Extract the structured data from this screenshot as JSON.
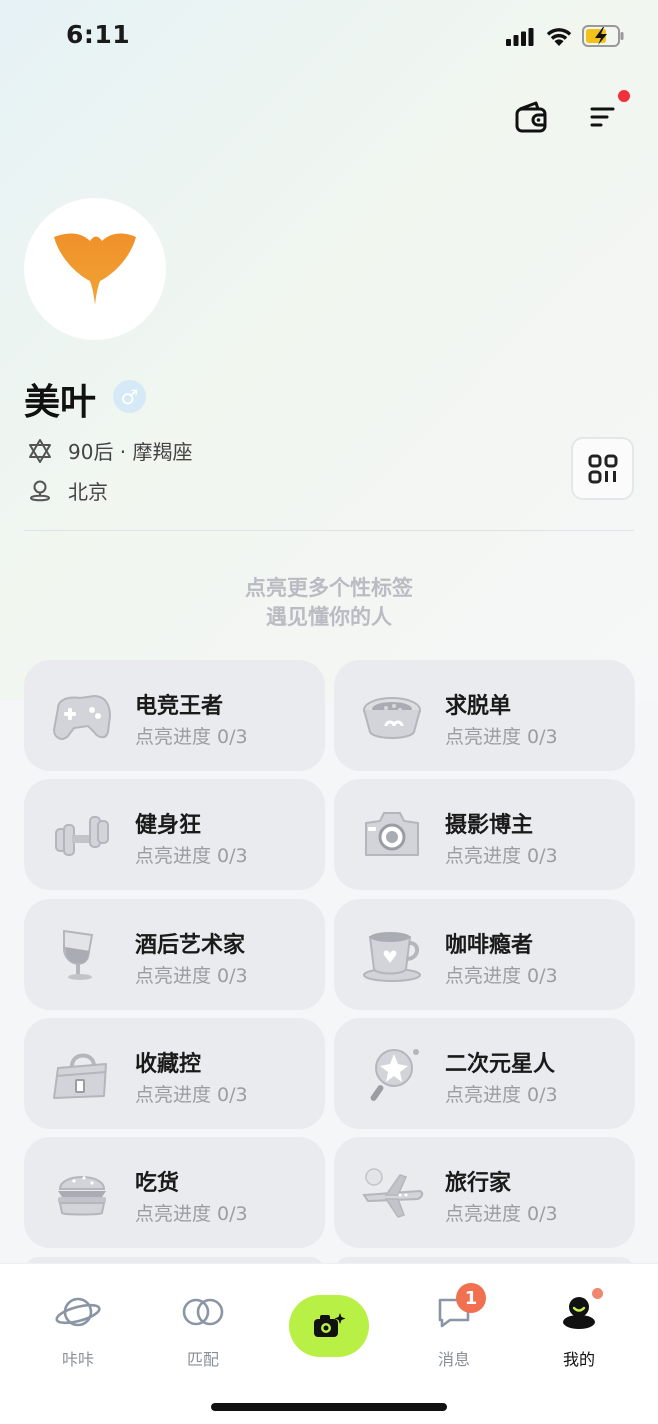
{
  "status_bar": {
    "time": "6:11"
  },
  "profile": {
    "name": "美叶",
    "gender_symbol": "♂",
    "birth_info": "90后 · 摩羯座",
    "location": "北京"
  },
  "slogan": {
    "line1": "点亮更多个性标签",
    "line2": "遇见懂你的人"
  },
  "tags": [
    {
      "title": "电竞王者",
      "progress": "点亮进度 0/3",
      "icon": "gamepad-icon"
    },
    {
      "title": "求脱单",
      "progress": "点亮进度 0/3",
      "icon": "pet-bowl-icon"
    },
    {
      "title": "健身狂",
      "progress": "点亮进度 0/3",
      "icon": "dumbbell-icon"
    },
    {
      "title": "摄影博主",
      "progress": "点亮进度 0/3",
      "icon": "camera-icon"
    },
    {
      "title": "酒后艺术家",
      "progress": "点亮进度 0/3",
      "icon": "wine-glass-icon"
    },
    {
      "title": "咖啡瘾者",
      "progress": "点亮进度 0/3",
      "icon": "coffee-cup-icon"
    },
    {
      "title": "收藏控",
      "progress": "点亮进度 0/3",
      "icon": "handbag-icon"
    },
    {
      "title": "二次元星人",
      "progress": "点亮进度 0/3",
      "icon": "magic-wand-icon"
    },
    {
      "title": "吃货",
      "progress": "点亮进度 0/3",
      "icon": "burger-icon"
    },
    {
      "title": "旅行家",
      "progress": "点亮进度 0/3",
      "icon": "airplane-icon"
    }
  ],
  "tabbar": {
    "tabs": [
      {
        "label": "咔咔",
        "icon": "planet-icon"
      },
      {
        "label": "匹配",
        "icon": "match-rings-icon"
      },
      {
        "label": "消息",
        "icon": "chat-icon"
      },
      {
        "label": "我的",
        "icon": "profile-icon"
      }
    ],
    "center_icon": "camera-sparkle-icon",
    "message_badge": "1"
  },
  "colors": {
    "accent_green": "#b8f046",
    "badge_orange": "#f07050",
    "notification_red": "#f0303a",
    "logo_orange": "#ee8d2a"
  }
}
